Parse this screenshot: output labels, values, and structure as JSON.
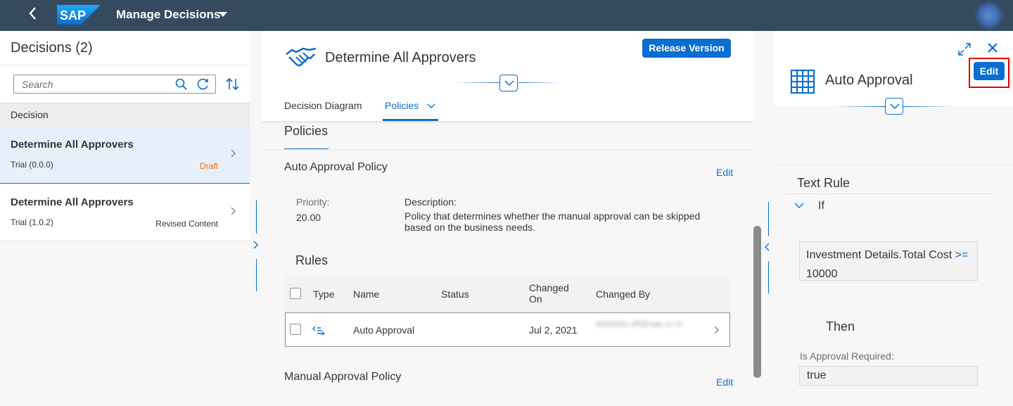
{
  "shell": {
    "title": "Manage Decisions",
    "logo": "SAP"
  },
  "left": {
    "title": "Decisions (2)",
    "search_placeholder": "Search",
    "column_header": "Decision",
    "items": [
      {
        "title": "Determine All Approvers",
        "version": "Trial (0.0.0)",
        "status": "Draft"
      },
      {
        "title": "Determine All Approvers",
        "version": "Trial (1.0.2)",
        "status": "Revised Content"
      }
    ]
  },
  "middle": {
    "title": "Determine All Approvers",
    "release_label": "Release Version",
    "tabs": [
      {
        "label": "Decision Diagram"
      },
      {
        "label": "Policies"
      }
    ],
    "section_title": "Policies",
    "policy1": {
      "title": "Auto Approval Policy",
      "edit_label": "Edit",
      "priority_label": "Priority:",
      "priority_value": "20.00",
      "description_label": "Description:",
      "description_value": "Policy that determines whether the manual approval can be skipped based on the business needs."
    },
    "rules_title": "Rules",
    "rules_columns": {
      "type": "Type",
      "name": "Name",
      "status": "Status",
      "changed_on": "Changed On",
      "changed_by": "Changed By"
    },
    "rules_rows": [
      {
        "name": "Auto Approval",
        "status": "",
        "changed_on": "Jul 2, 2021",
        "changed_by": "ddddddo.dfl@sap.co m"
      }
    ],
    "policy2": {
      "title": "Manual Approval Policy",
      "edit_label": "Edit"
    }
  },
  "right": {
    "title": "Auto Approval",
    "edit_label": "Edit",
    "text_rule_title": "Text Rule",
    "if_label": "If",
    "condition": {
      "field": "Investment Details.Total Cost",
      "operator": ">=",
      "value": "10000"
    },
    "then_label": "Then",
    "result_label": "Is Approval Required:",
    "result_value": "true"
  },
  "colors": {
    "shell": "#354a5f",
    "accent": "#0a6ed1",
    "draft": "#e9730c",
    "highlight": "#e60000"
  }
}
